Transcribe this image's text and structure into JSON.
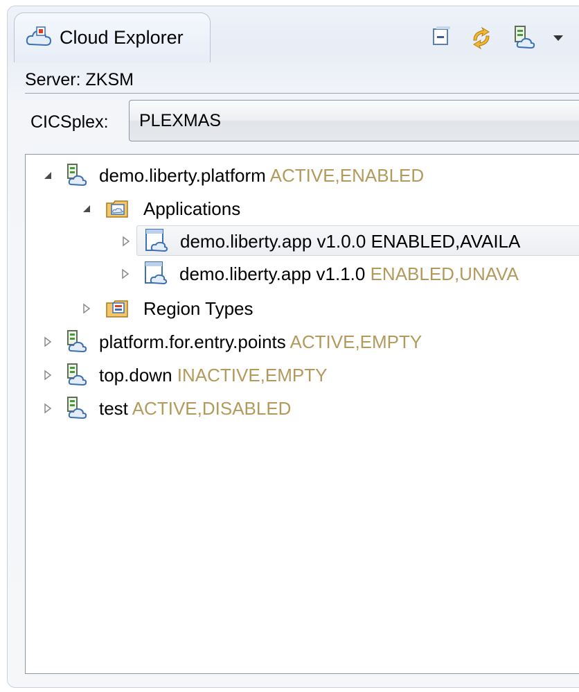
{
  "view": {
    "tab_title": "Cloud Explorer",
    "tab_icon": "cloud-explorer-icon",
    "toolbar": [
      {
        "name": "collapse-all-icon"
      },
      {
        "name": "refresh-sync-icon"
      },
      {
        "name": "platform-menu-icon"
      }
    ]
  },
  "server": {
    "label": "Server: ZKSM"
  },
  "cicsplex": {
    "label": "CICSplex:",
    "selected": "PLEXMAS"
  },
  "colors": {
    "status_text": "#b39a5c",
    "selection_bg": "#eceef1"
  },
  "tree": {
    "items": [
      {
        "name": "demo.liberty.platform",
        "status": "ACTIVE,ENABLED",
        "expanded": true,
        "icon": "platform-icon"
      },
      {
        "name": "Applications",
        "status": "",
        "expanded": true,
        "icon": "applications-folder-icon"
      },
      {
        "name": "demo.liberty.app v1.0.0 ENABLED,AVAILA",
        "status": "",
        "expanded": false,
        "icon": "application-icon",
        "selected": true
      },
      {
        "name": "demo.liberty.app v1.1.0",
        "status": "ENABLED,UNAVA",
        "expanded": false,
        "icon": "application-icon"
      },
      {
        "name": "Region Types",
        "status": "",
        "expanded": false,
        "icon": "region-types-folder-icon"
      },
      {
        "name": "platform.for.entry.points",
        "status": "ACTIVE,EMPTY",
        "expanded": false,
        "icon": "platform-icon"
      },
      {
        "name": "top.down",
        "status": "INACTIVE,EMPTY",
        "expanded": false,
        "icon": "platform-icon"
      },
      {
        "name": "test",
        "status": "ACTIVE,DISABLED",
        "expanded": false,
        "icon": "platform-icon"
      }
    ]
  }
}
